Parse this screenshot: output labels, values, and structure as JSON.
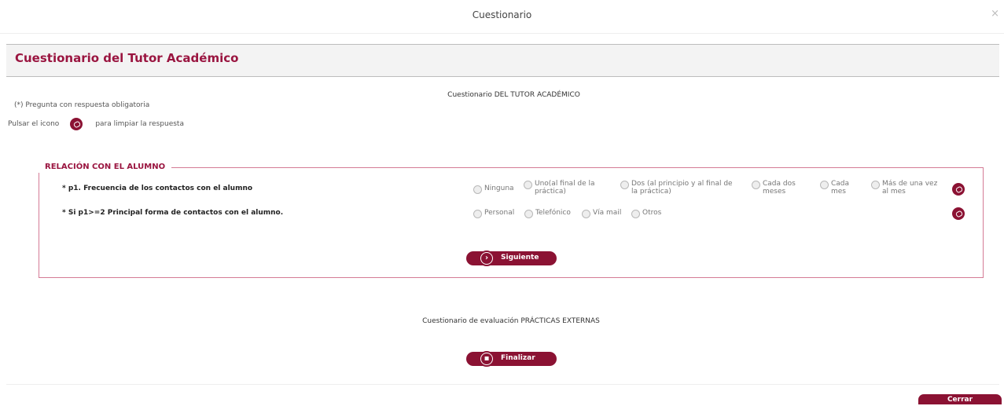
{
  "window": {
    "title": "Cuestionario",
    "close_glyph": "×"
  },
  "section": {
    "title": "Cuestionario del Tutor Académico"
  },
  "questionnaire": {
    "title": "Cuestionario DEL TUTOR ACADÉMICO",
    "mandatory_note": "(*) Pregunta con respuesta obligatoria",
    "hint_before": "Pulsar el icono",
    "hint_after": "para limpiar la respuesta"
  },
  "group": {
    "legend": "RELACIÓN CON EL ALUMNO",
    "q1": {
      "label": "* p1. Frecuencia de los contactos con el alumno",
      "options": [
        "Ninguna",
        "Uno(al final de la práctica)",
        "Dos (al principio y al final de la práctica)",
        "Cada dos meses",
        "Cada mes",
        "Más de una vez al mes"
      ]
    },
    "q2": {
      "label": "* Si p1>=2 Principal forma de contactos con el alumno.",
      "options": [
        "Personal",
        "Telefónico",
        "Vía mail",
        "Otros"
      ]
    },
    "next_label": "Siguiente"
  },
  "evaluation": {
    "title": "Cuestionario de evaluación PRÁCTICAS EXTERNAS",
    "finish_label": "Finalizar"
  },
  "footer": {
    "close_label": "Cerrar"
  },
  "icons": {
    "clear": "eraser-icon",
    "next": "chevron-right-icon",
    "finish": "save-icon"
  },
  "colors": {
    "accent": "#8b1233",
    "title": "#9a1540",
    "border": "#d47b95"
  }
}
